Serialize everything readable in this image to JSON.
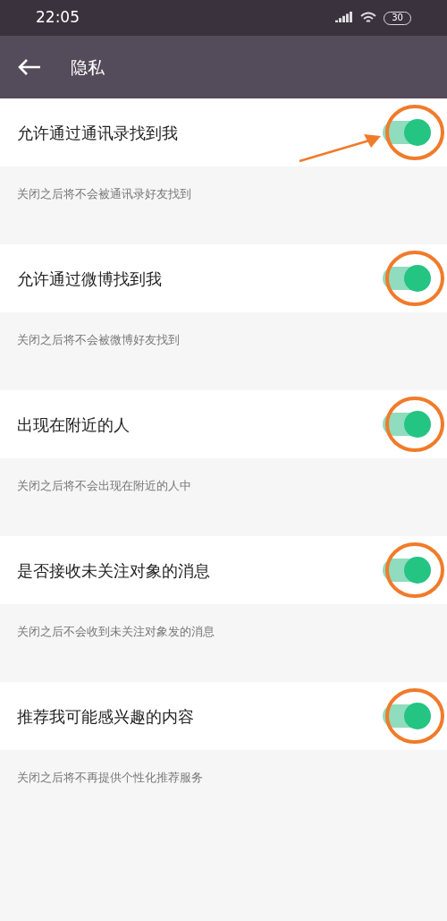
{
  "status_bar": {
    "time": "22:05",
    "battery": "30"
  },
  "header": {
    "title": "隐私"
  },
  "settings": [
    {
      "label": "允许通过通讯录找到我",
      "description": "关闭之后将不会被通讯录好友找到",
      "on": true,
      "circled": true,
      "arrow": true
    },
    {
      "label": "允许通过微博找到我",
      "description": "关闭之后将不会被微博好友找到",
      "on": true,
      "circled": true,
      "arrow": false
    },
    {
      "label": "出现在附近的人",
      "description": "关闭之后将不会出现在附近的人中",
      "on": true,
      "circled": true,
      "arrow": false
    },
    {
      "label": "是否接收未关注对象的消息",
      "description": "关闭之后不会收到未关注对象发的消息",
      "on": true,
      "circled": true,
      "arrow": false
    },
    {
      "label": "推荐我可能感兴趣的内容",
      "description": "关闭之后将不再提供个性化推荐服务",
      "on": true,
      "circled": true,
      "arrow": false
    }
  ]
}
